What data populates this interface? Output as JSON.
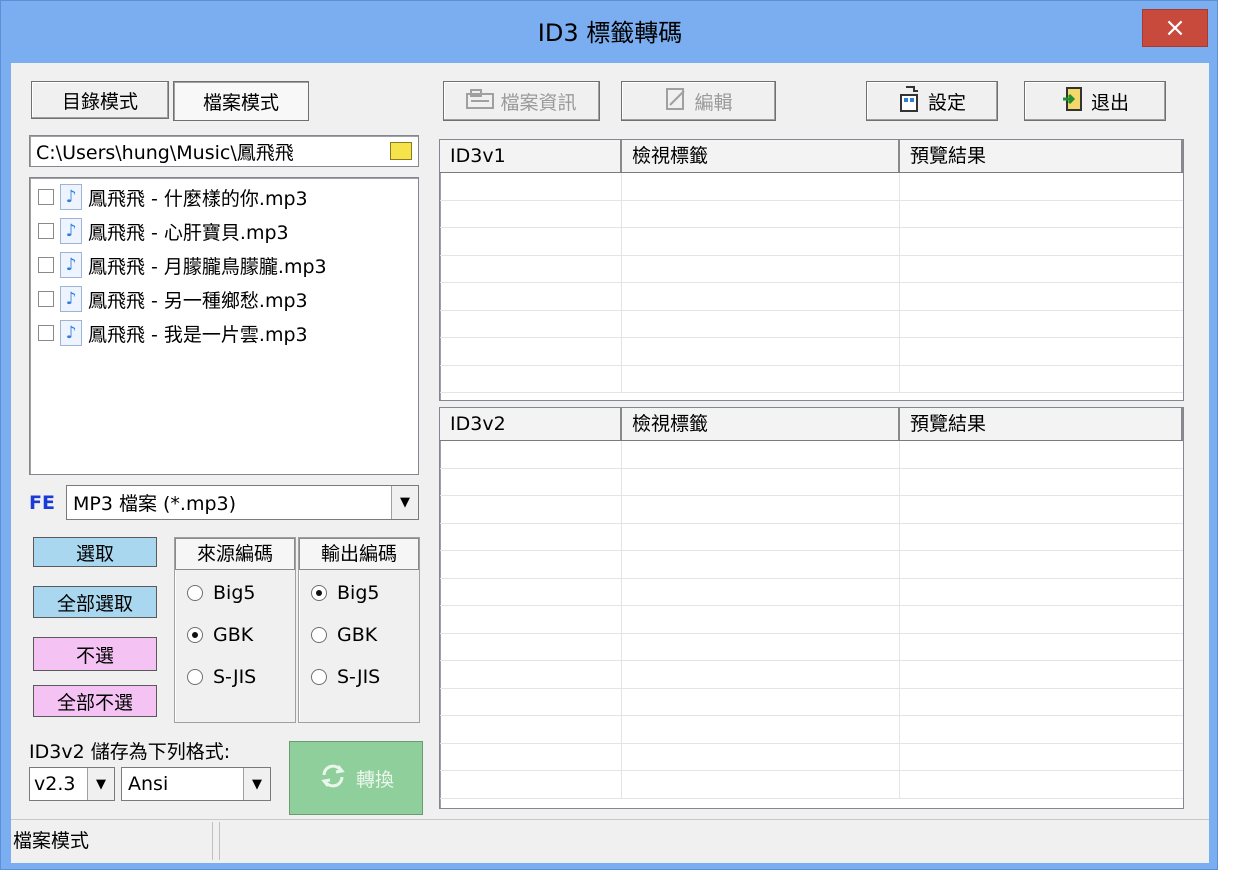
{
  "window": {
    "title": "ID3 標籤轉碼",
    "close_label": "×"
  },
  "mode_tabs": {
    "dir_mode": "目錄模式",
    "file_mode": "檔案模式"
  },
  "toolbar": {
    "file_info": "檔案資訊",
    "edit": "編輯",
    "settings": "設定",
    "exit": "退出"
  },
  "path": {
    "value": "C:\\Users\\hung\\Music\\鳳飛飛"
  },
  "files": [
    "鳳飛飛 - 什麼樣的你.mp3",
    "鳳飛飛 - 心肝寶貝.mp3",
    "鳳飛飛 - 月朦朧鳥朦朧.mp3",
    "鳳飛飛 - 另一種鄉愁.mp3",
    "鳳飛飛 - 我是一片雲.mp3"
  ],
  "filter": {
    "badge": "FE",
    "value": "MP3 檔案 (*.mp3)"
  },
  "selection": {
    "select": "選取",
    "select_all": "全部選取",
    "deselect": "不選",
    "deselect_all": "全部不選"
  },
  "source_encoding": {
    "header": "來源編碼",
    "options": [
      "Big5",
      "GBK",
      "S-JIS"
    ],
    "selected": "GBK"
  },
  "output_encoding": {
    "header": "輸出編碼",
    "options": [
      "Big5",
      "GBK",
      "S-JIS"
    ],
    "selected": "Big5"
  },
  "id3v2_save": {
    "label": "ID3v2 儲存為下列格式:",
    "version": "v2.3",
    "encoding": "Ansi"
  },
  "convert": {
    "label": "轉換"
  },
  "grid_v1": {
    "columns": [
      "ID3v1",
      "檢視標籤",
      "預覽結果"
    ]
  },
  "grid_v2": {
    "columns": [
      "ID3v2",
      "檢視標籤",
      "預覽結果"
    ]
  },
  "statusbar": {
    "mode": "檔案模式",
    "message": ""
  },
  "colors": {
    "title_bar": "#7aaef0",
    "close": "#c74a3c",
    "select_btn": "#a9d7f0",
    "deselect_btn": "#f4c3f4",
    "convert_btn": "#8fcf9b"
  }
}
